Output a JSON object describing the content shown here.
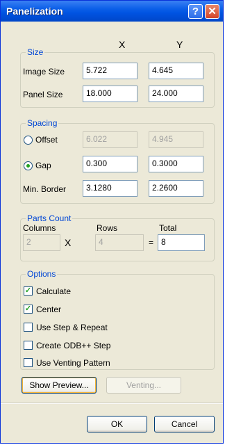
{
  "window": {
    "title": "Panelization",
    "help_glyph": "?",
    "close_glyph": "✕"
  },
  "columns": {
    "x": "X",
    "y": "Y"
  },
  "size": {
    "legend": "Size",
    "image_label": "Image Size",
    "image_x": "5.722",
    "image_y": "4.645",
    "panel_label": "Panel Size",
    "panel_x": "18.000",
    "panel_y": "24.000"
  },
  "spacing": {
    "legend": "Spacing",
    "offset_label": "Offset",
    "offset_x": "6.022",
    "offset_y": "4.945",
    "gap_label": "Gap",
    "gap_x": "0.300",
    "gap_y": "0.3000",
    "minborder_label": "Min. Border",
    "minborder_x": "3.1280",
    "minborder_y": "2.2600",
    "selected": "Gap"
  },
  "parts": {
    "legend": "Parts Count",
    "columns_label": "Columns",
    "rows_label": "Rows",
    "total_label": "Total",
    "columns": "2",
    "rows": "4",
    "total": "8",
    "times": "X",
    "equals": "="
  },
  "options": {
    "legend": "Options",
    "items": [
      {
        "label": "Calculate",
        "checked": true
      },
      {
        "label": "Center",
        "checked": true
      },
      {
        "label": "Use Step & Repeat",
        "checked": false
      },
      {
        "label": "Create ODB++ Step",
        "checked": false
      },
      {
        "label": "Use Venting Pattern",
        "checked": false
      }
    ]
  },
  "buttons": {
    "preview": "Show Preview...",
    "venting": "Venting...",
    "ok": "OK",
    "cancel": "Cancel"
  }
}
